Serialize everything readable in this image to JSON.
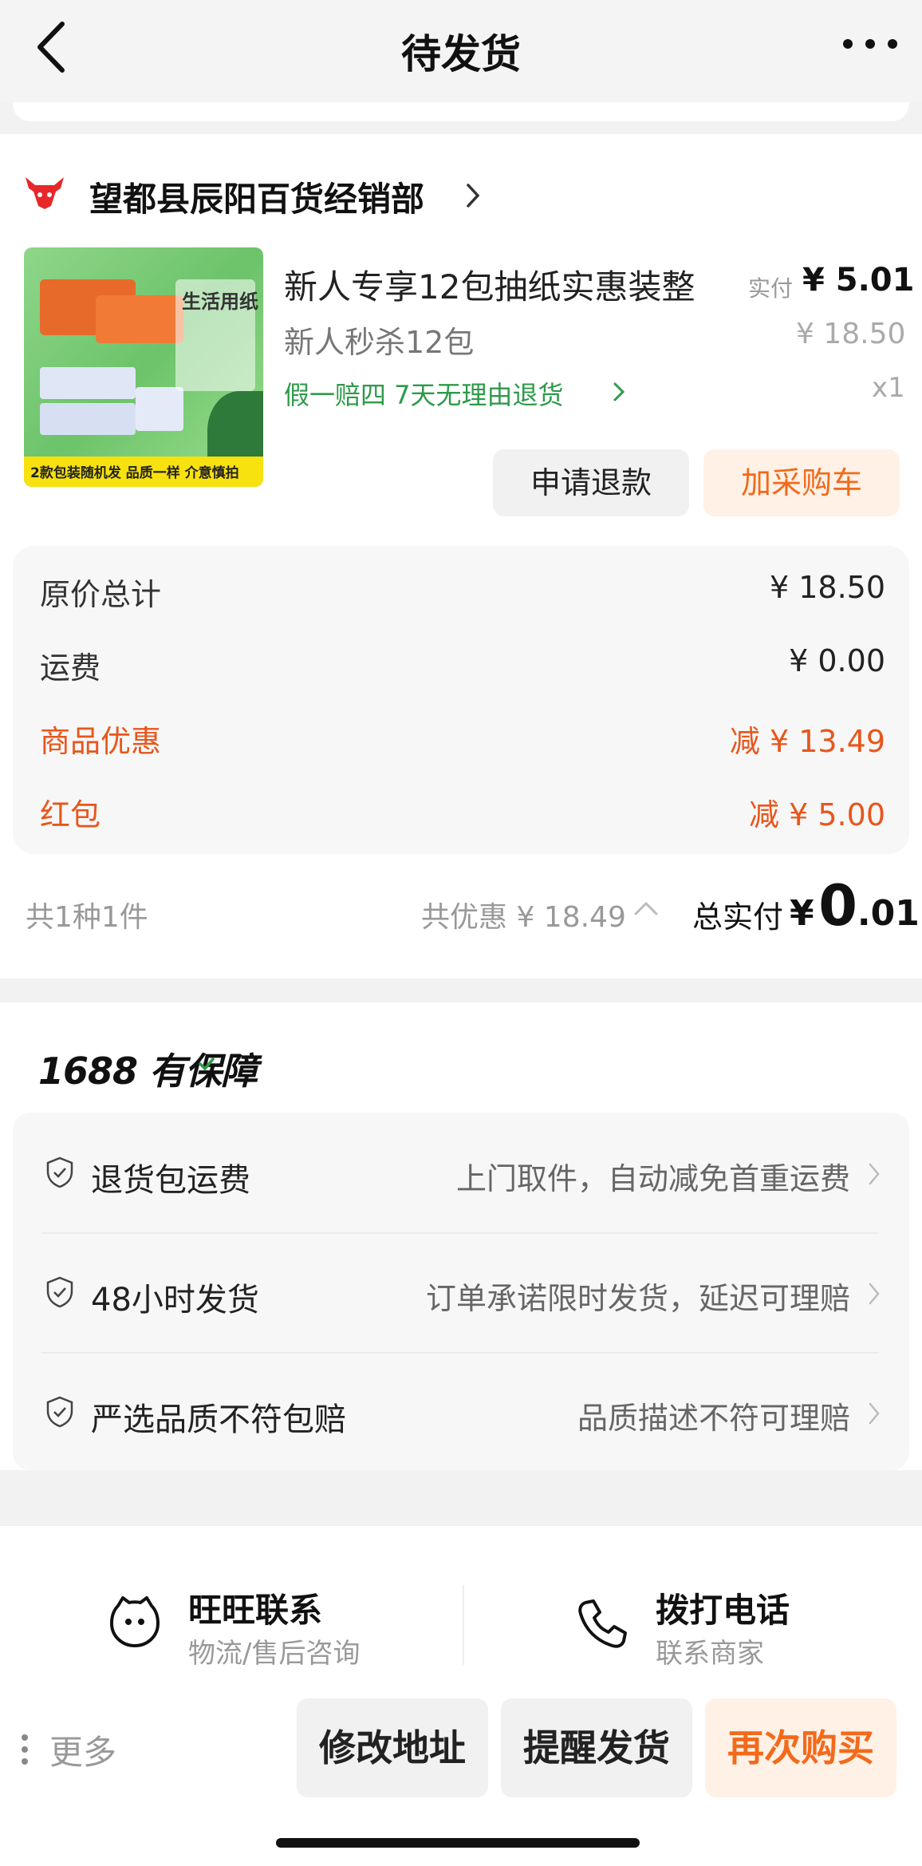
{
  "header": {
    "title": "待发货"
  },
  "shop": {
    "name": "望都县辰阳百货经销部"
  },
  "product": {
    "image_sign_text": "生活用纸",
    "image_banner_text": "2款包装随机发 品质一样 介意慎拍",
    "title": "新人专享12包抽纸实惠装整",
    "sku": "新人秒杀12包",
    "guarantee": "假一赔四  7天无理由退货",
    "actual_label": "实付",
    "actual_price": "¥ 5.01",
    "original_price": "¥ 18.50",
    "quantity": "x1",
    "refund_button": "申请退款",
    "add_cart_button": "加采购车"
  },
  "price_details": {
    "rows": [
      {
        "label": "原价总计",
        "value": "¥ 18.50"
      },
      {
        "label": "运费",
        "value": "¥ 0.00"
      },
      {
        "label": "商品优惠",
        "value": "减  ¥ 13.49"
      },
      {
        "label": "红包",
        "value": "减  ¥ 5.00"
      }
    ]
  },
  "summary": {
    "count": "共1种1件",
    "discount": "共优惠 ¥ 18.49",
    "total_label": "总实付",
    "total_currency": "¥",
    "total_int": "0",
    "total_dec": ".01"
  },
  "guarantee": {
    "logo": "1688 有保障",
    "rows": [
      {
        "label": "退货包运费",
        "desc": "上门取件，自动减免首重运费"
      },
      {
        "label": "48小时发货",
        "desc": "订单承诺限时发货，延迟可理赔"
      },
      {
        "label": "严选品质不符包赔",
        "desc": "品质描述不符可理赔"
      }
    ]
  },
  "contact": {
    "wangwang_title": "旺旺联系",
    "wangwang_sub": "物流/售后咨询",
    "phone_title": "拨打电话",
    "phone_sub": "联系商家"
  },
  "bottom_bar": {
    "more": "更多",
    "modify_address": "修改地址",
    "remind_ship": "提醒发货",
    "buy_again": "再次购买"
  },
  "colors": {
    "accent": "#f26a1b",
    "discount_red": "#e8561c",
    "guarantee_green": "#2e9a4a"
  }
}
